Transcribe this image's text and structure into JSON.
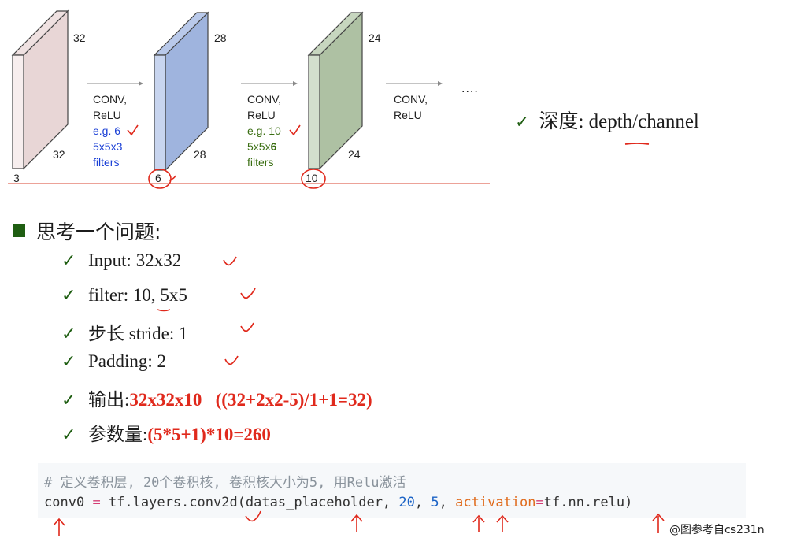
{
  "diagram": {
    "volumes": [
      {
        "id": "input",
        "height": "32",
        "width": "32",
        "depth": "3"
      },
      {
        "id": "conv1",
        "height": "28",
        "width": "28",
        "depth": "6"
      },
      {
        "id": "conv2",
        "height": "24",
        "width": "24",
        "depth": "10"
      }
    ],
    "stages": [
      {
        "op1": "CONV,",
        "op2": "ReLU",
        "eg": "e.g. 6",
        "size": "5x5x3",
        "filters": "filters"
      },
      {
        "op1": "CONV,",
        "op2": "ReLU",
        "eg": "e.g. 10",
        "size_prefix": "5x5x",
        "size_bold": "6",
        "filters": "filters"
      },
      {
        "op1": "CONV,",
        "op2": "ReLU"
      }
    ],
    "ellipsis": "....",
    "colors": {
      "input": "#e8d6d6",
      "conv1": "#a9bde3",
      "conv2": "#b7c9ac",
      "annotation": "#e0291c"
    }
  },
  "depth_note": {
    "label": "深度:",
    "value": "depth/channel"
  },
  "question": {
    "title": "思考一个问题:"
  },
  "items": [
    {
      "label": "Input: 32x32"
    },
    {
      "label": "filter:",
      "value": "10, 5x5"
    },
    {
      "label": "步长 stride:",
      "value": "1"
    },
    {
      "label": "Padding: 2"
    },
    {
      "label": "输出:",
      "value": "32x32x10",
      "formula": "((32+2x2-5)/1+1=32)"
    },
    {
      "label": "参数量:",
      "value": "(5*5+1)*10=260"
    }
  ],
  "code": {
    "comment": "# 定义卷积层, 20个卷积核, 卷积核大小为5, 用Relu激活",
    "line_prefix": "conv0",
    "line_eq": "=",
    "line_call": "tf.layers.conv2d(datas_placeholder,",
    "arg1": "20",
    "comma1": ",",
    "arg2": "5",
    "comma2": ",",
    "kwname": "activation",
    "kweq": "=",
    "kwval": "tf.nn.relu)"
  },
  "credit": "@图参考自cs231n"
}
